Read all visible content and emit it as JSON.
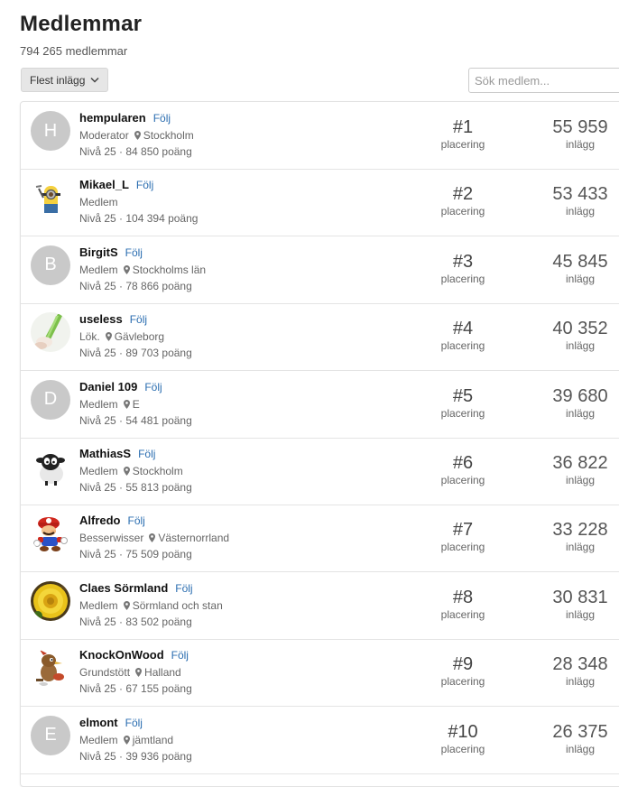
{
  "page": {
    "title": "Medlemmar",
    "member_count": "794 265 medlemmar",
    "sort_label": "Flest inlägg",
    "search_placeholder": "Sök medlem..."
  },
  "members": [
    {
      "name": "hempularen",
      "follow": "Följ",
      "role": "Moderator",
      "location": "Stockholm",
      "level": "Nivå 25",
      "points": "84 850 poäng",
      "rank": "#1",
      "rank_label": "placering",
      "posts": "55 959",
      "posts_label": "inlägg",
      "avatar": {
        "type": "letter",
        "letter": "H"
      }
    },
    {
      "name": "Mikael_L",
      "follow": "Följ",
      "role": "Medlem",
      "location": "",
      "level": "Nivå 25",
      "points": "104 394 poäng",
      "rank": "#2",
      "rank_label": "placering",
      "posts": "53 433",
      "posts_label": "inlägg",
      "avatar": {
        "type": "image",
        "icon": "minion-icon"
      }
    },
    {
      "name": "BirgitS",
      "follow": "Följ",
      "role": "Medlem",
      "location": "Stockholms län",
      "level": "Nivå 25",
      "points": "78 866 poäng",
      "rank": "#3",
      "rank_label": "placering",
      "posts": "45 845",
      "posts_label": "inlägg",
      "avatar": {
        "type": "letter",
        "letter": "B"
      }
    },
    {
      "name": "useless",
      "follow": "Följ",
      "role": "Lök.",
      "location": "Gävleborg",
      "level": "Nivå 25",
      "points": "89 703 poäng",
      "rank": "#4",
      "rank_label": "placering",
      "posts": "40 352",
      "posts_label": "inlägg",
      "avatar": {
        "type": "image",
        "icon": "leek-icon"
      }
    },
    {
      "name": "Daniel 109",
      "follow": "Följ",
      "role": "Medlem",
      "location": "E",
      "level": "Nivå 25",
      "points": "54 481 poäng",
      "rank": "#5",
      "rank_label": "placering",
      "posts": "39 680",
      "posts_label": "inlägg",
      "avatar": {
        "type": "letter",
        "letter": "D"
      }
    },
    {
      "name": "MathiasS",
      "follow": "Följ",
      "role": "Medlem",
      "location": "Stockholm",
      "level": "Nivå 25",
      "points": "55 813 poäng",
      "rank": "#6",
      "rank_label": "placering",
      "posts": "36 822",
      "posts_label": "inlägg",
      "avatar": {
        "type": "image",
        "icon": "sheep-icon"
      }
    },
    {
      "name": "Alfredo",
      "follow": "Följ",
      "role": "Besserwisser",
      "location": "Västernorrland",
      "level": "Nivå 25",
      "points": "75 509 poäng",
      "rank": "#7",
      "rank_label": "placering",
      "posts": "33 228",
      "posts_label": "inlägg",
      "avatar": {
        "type": "image",
        "icon": "mario-icon"
      }
    },
    {
      "name": "Claes Sörmland",
      "follow": "Följ",
      "role": "Medlem",
      "location": "Sörmland och stan",
      "level": "Nivå 25",
      "points": "83 502 poäng",
      "rank": "#8",
      "rank_label": "placering",
      "posts": "30 831",
      "posts_label": "inlägg",
      "avatar": {
        "type": "image",
        "icon": "flower-icon"
      }
    },
    {
      "name": "KnockOnWood",
      "follow": "Följ",
      "role": "Grundstött",
      "location": "Halland",
      "level": "Nivå 25",
      "points": "67 155 poäng",
      "rank": "#9",
      "rank_label": "placering",
      "posts": "28 348",
      "posts_label": "inlägg",
      "avatar": {
        "type": "image",
        "icon": "woodpecker-icon"
      }
    },
    {
      "name": "elmont",
      "follow": "Följ",
      "role": "Medlem",
      "location": "jämtland",
      "level": "Nivå 25",
      "points": "39 936 poäng",
      "rank": "#10",
      "rank_label": "placering",
      "posts": "26 375",
      "posts_label": "inlägg",
      "avatar": {
        "type": "letter",
        "letter": "E"
      }
    }
  ]
}
